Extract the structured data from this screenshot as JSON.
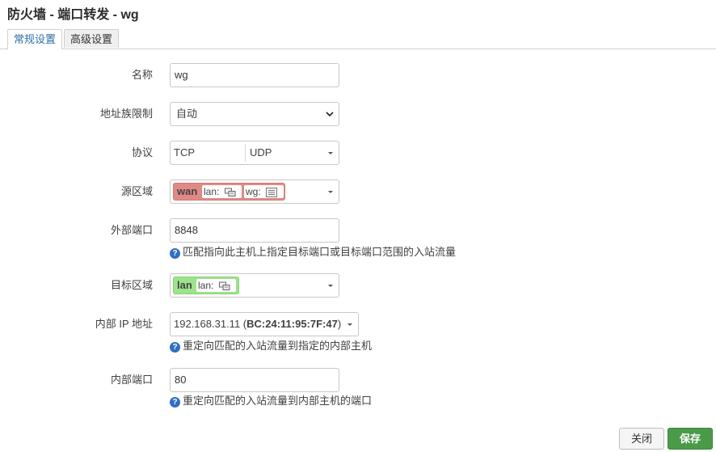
{
  "title": "防火墙 - 端口转发 - wg",
  "tabs": [
    {
      "label": "常规设置",
      "active": true
    },
    {
      "label": "高级设置",
      "active": false
    }
  ],
  "form": {
    "name": {
      "label": "名称",
      "value": "wg"
    },
    "family": {
      "label": "地址族限制",
      "value": "自动"
    },
    "protocol": {
      "label": "协议",
      "values": [
        "TCP",
        "UDP"
      ]
    },
    "src_zone": {
      "label": "源区域",
      "zone": "wan",
      "zone_color": "#e08a86",
      "networks": [
        "lan:",
        "wg:"
      ]
    },
    "ext_port": {
      "label": "外部端口",
      "value": "8848",
      "help": "匹配指向此主机上指定目标端口或目标端口范围的入站流量"
    },
    "dest_zone": {
      "label": "目标区域",
      "zone": "lan",
      "zone_color": "#9de38b",
      "networks": [
        "lan:"
      ]
    },
    "int_ip": {
      "label": "内部 IP 地址",
      "ip": "192.168.31.11 (",
      "mac_prefix": "BC",
      "mac_rest": ":24:11:95:7F:47",
      "suffix": ")",
      "help": "重定向匹配的入站流量到指定的内部主机"
    },
    "int_port": {
      "label": "内部端口",
      "value": "80",
      "help": "重定向匹配的入站流量到内部主机的端口"
    }
  },
  "help_icon": "question-circle-icon",
  "buttons": {
    "close": "关闭",
    "save": "保存",
    "save_color": "#4a9a4a"
  }
}
